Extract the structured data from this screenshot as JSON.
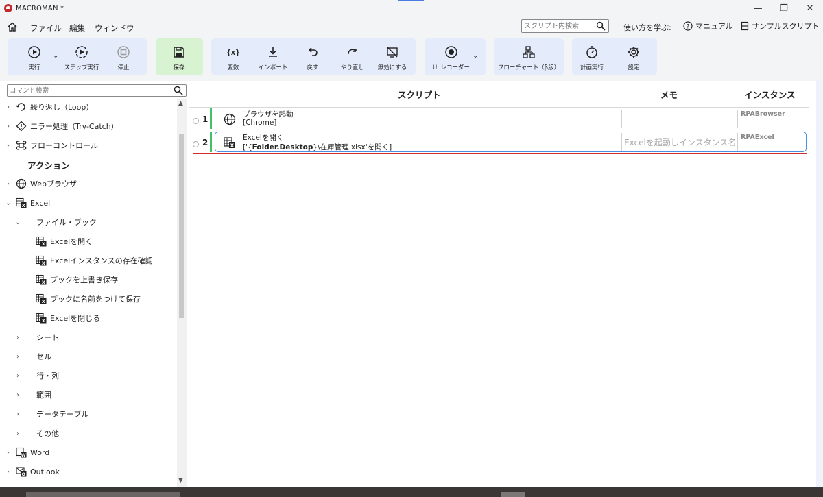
{
  "window": {
    "title": "MACROMAN *",
    "controls": {
      "minimize": "—",
      "maximize": "❐",
      "close": "✕"
    }
  },
  "menu": {
    "items": [
      "ファイル",
      "編集",
      "ウィンドウ"
    ],
    "search_placeholder": "スクリプト内検索",
    "learn_label": "使い方を学ぶ:",
    "manual_label": "マニュアル",
    "sample_label": "サンプルスクリプト"
  },
  "toolbar": {
    "run": "実行",
    "step_run": "ステップ実行",
    "stop": "停止",
    "save": "保存",
    "variable": "変数",
    "import": "インポート",
    "undo": "戻す",
    "redo": "やり直し",
    "disable": "無効にする",
    "ui_recorder": "UI レコーダー",
    "flowchart": "フローチャート（β版）",
    "schedule": "計画実行",
    "settings": "設定"
  },
  "sidebar": {
    "search_placeholder": "コマンド検索",
    "items": [
      {
        "label": "繰り返し（Loop）",
        "chev": "›",
        "icon": "loop-icon"
      },
      {
        "label": "エラー処理（Try-Catch）",
        "chev": "›",
        "icon": "warning-icon"
      },
      {
        "label": "フローコントロール",
        "chev": "›",
        "icon": "command-icon"
      },
      {
        "label": "アクション",
        "section": true
      },
      {
        "label": "Webブラウザ",
        "chev": "›",
        "icon": "globe-icon"
      },
      {
        "label": "Excel",
        "chev": "⌄",
        "icon": "excel-icon"
      },
      {
        "label": "ファイル・ブック",
        "chev": "⌄",
        "indent": 1
      },
      {
        "label": "Excelを開く",
        "indent": 2,
        "icon": "excel-icon"
      },
      {
        "label": "Excelインスタンスの存在確認",
        "indent": 2,
        "icon": "excel-icon"
      },
      {
        "label": "ブックを上書き保存",
        "indent": 2,
        "icon": "excel-icon"
      },
      {
        "label": "ブックに名前をつけて保存",
        "indent": 2,
        "icon": "excel-icon"
      },
      {
        "label": "Excelを閉じる",
        "indent": 2,
        "icon": "excel-icon"
      },
      {
        "label": "シート",
        "chev": "›",
        "indent": 1
      },
      {
        "label": "セル",
        "chev": "›",
        "indent": 1
      },
      {
        "label": "行・列",
        "chev": "›",
        "indent": 1
      },
      {
        "label": "範囲",
        "chev": "›",
        "indent": 1
      },
      {
        "label": "データテーブル",
        "chev": "›",
        "indent": 1
      },
      {
        "label": "その他",
        "chev": "›",
        "indent": 1
      },
      {
        "label": "Word",
        "chev": "›",
        "icon": "word-icon"
      },
      {
        "label": "Outlook",
        "chev": "›",
        "icon": "outlook-icon"
      }
    ]
  },
  "script": {
    "headers": {
      "script": "スクリプト",
      "memo": "メモ",
      "instance": "インスタンス"
    },
    "rows": [
      {
        "num": "1",
        "title": "ブラウザを起動",
        "detail": "[Chrome]",
        "memo": "",
        "instance": "RPABrowser"
      },
      {
        "num": "2",
        "title": "Excelを開く",
        "detail_prefix": "['{",
        "detail_bold": "Folder.Desktop",
        "detail_suffix": "}\\在庫管理.xlsx'を開く]",
        "memo": "Excelを起動しインスタンス名",
        "instance": "RPAExcel"
      }
    ]
  },
  "colors": {
    "accent": "#4a90e2",
    "row_bar": "#43c16a",
    "error_line": "#d32f2f",
    "save_group": "#d8f3d2",
    "toolbar_group": "#e4ebfa"
  }
}
